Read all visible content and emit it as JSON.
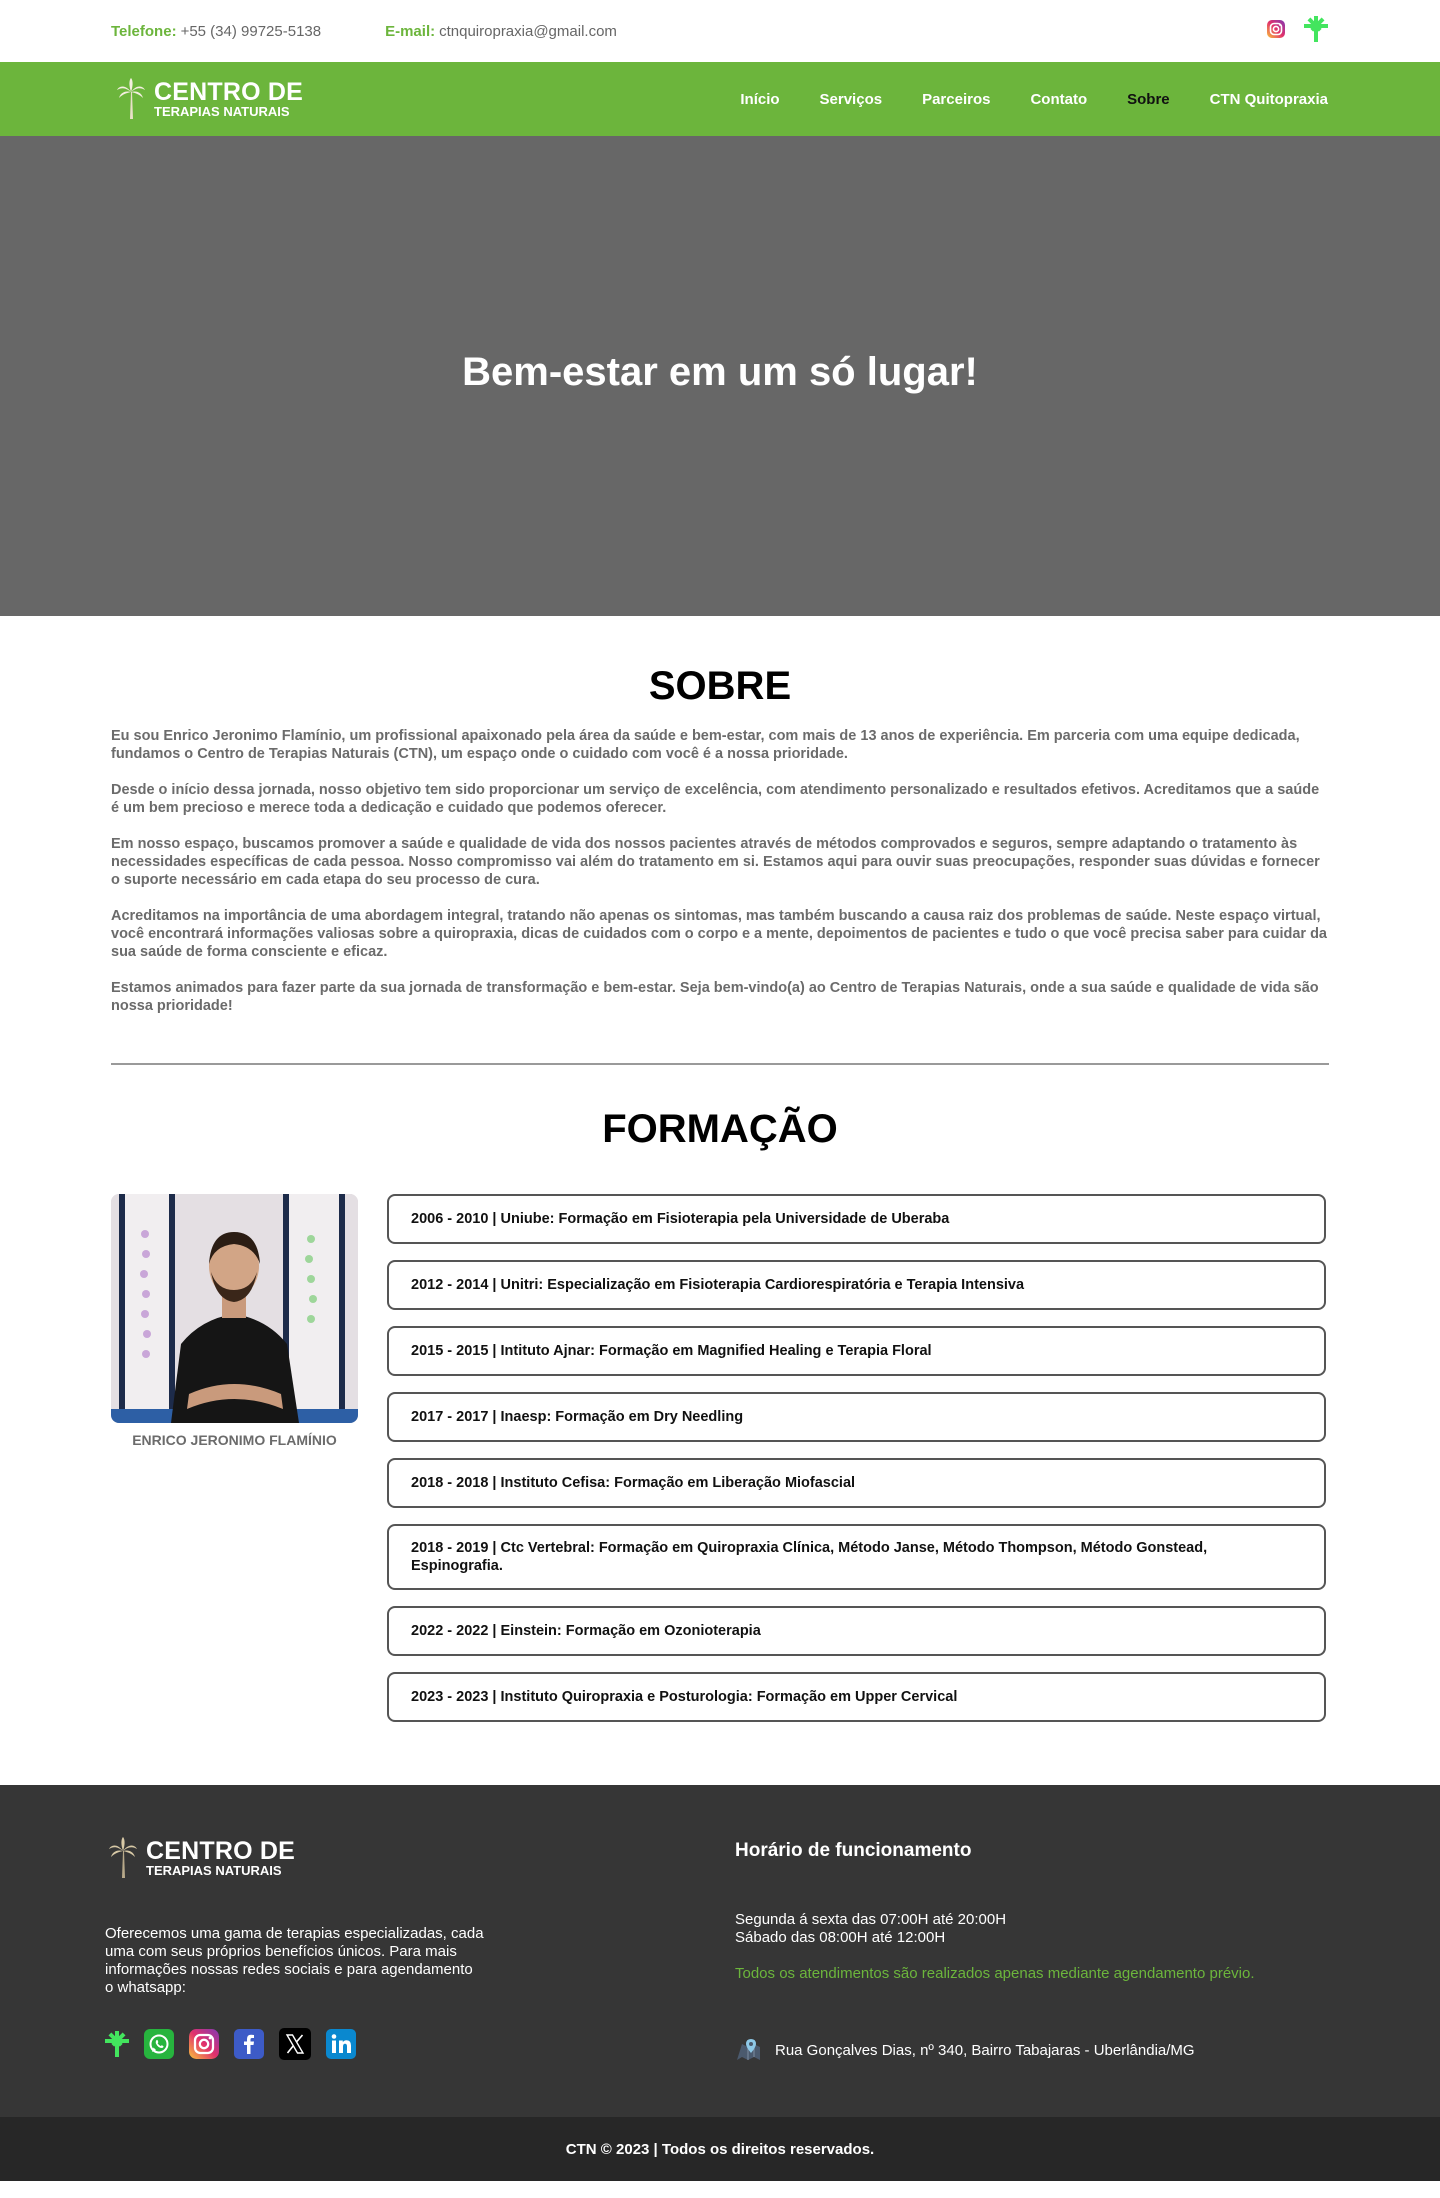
{
  "topbar": {
    "phone_label": "Telefone:",
    "phone_value": "+55 (34) 99725-5138",
    "email_label": "E-mail:",
    "email_value": "ctnquiropraxia@gmail.com",
    "social_icons": [
      "instagram-icon",
      "linktree-icon"
    ]
  },
  "brand": {
    "line1": "CENTRO DE",
    "line2": "TERAPIAS NATURAIS",
    "accent_color": "#6cb53c"
  },
  "nav": {
    "items": [
      {
        "label": "Início"
      },
      {
        "label": "Serviços"
      },
      {
        "label": "Parceiros"
      },
      {
        "label": "Contato"
      },
      {
        "label": "Sobre",
        "active": true
      },
      {
        "label": "CTN Quitopraxia"
      }
    ]
  },
  "hero": {
    "title": "Bem-estar em um só lugar!"
  },
  "sobre": {
    "title": "SOBRE",
    "paragraphs": [
      "Eu sou Enrico Jeronimo Flamínio, um profissional apaixonado pela área da saúde e bem-estar, com mais de 13 anos de experiência. Em parceria com uma equipe dedicada, fundamos o Centro de Terapias Naturais (CTN), um espaço onde o cuidado com você é a nossa prioridade.",
      "Desde o início dessa jornada, nosso objetivo tem sido proporcionar um serviço de excelência, com atendimento personalizado e resultados efetivos. Acreditamos que a saúde é um bem precioso e merece toda a dedicação e cuidado que podemos oferecer.",
      "Em nosso espaço, buscamos promover a saúde e qualidade de vida dos nossos pacientes através de métodos comprovados e seguros, sempre adaptando o tratamento às necessidades específicas de cada pessoa. Nosso compromisso vai além do tratamento em si. Estamos aqui para ouvir suas preocupações, responder suas dúvidas e fornecer o suporte necessário em cada etapa do seu processo de cura.",
      "Acreditamos na importância de uma abordagem integral, tratando não apenas os sintomas, mas também buscando a causa raiz dos problemas de saúde. Neste espaço virtual, você encontrará informações valiosas sobre a quiropraxia, dicas de cuidados com o corpo e a mente, depoimentos de pacientes e tudo o que você precisa saber para cuidar da sua saúde de forma consciente e eficaz.",
      "Estamos animados para fazer parte da sua jornada de transformação e bem-estar. Seja bem-vindo(a) ao Centro de Terapias Naturais, onde a sua saúde e qualidade de vida são nossa prioridade!"
    ]
  },
  "formacao": {
    "title": "FORMAÇÃO",
    "profile_name": "ENRICO JERONIMO FLAMÍNIO",
    "items": [
      "2006 - 2010 | Uniube: Formação em Fisioterapia pela Universidade de Uberaba",
      "2012 - 2014 | Unitri: Especialização em Fisioterapia Cardiorespiratória e Terapia Intensiva",
      "2015 - 2015 | Intituto Ajnar: Formação em Magnified Healing e Terapia Floral",
      "2017 - 2017 | Inaesp: Formação em Dry Needling",
      "2018 - 2018 | Instituto Cefisa: Formação em Liberação Miofascial",
      "2018 - 2019 | Ctc Vertebral: Formação em Quiropraxia Clínica, Método Janse, Método Thompson, Método Gonstead, Espinografia.",
      "2022 - 2022 | Einstein: Formação em Ozonioterapia",
      "2023 - 2023 | Instituto Quiropraxia e Posturologia: Formação em Upper Cervical"
    ]
  },
  "footer": {
    "description": "Oferecemos uma gama de terapias especializadas, cada uma com seus próprios benefícios únicos. Para mais informações nossas redes sociais e para agendamento o whatsapp:",
    "social_icons": [
      "linktree-icon",
      "whatsapp-icon",
      "instagram-icon",
      "facebook-icon",
      "x-icon",
      "linkedin-icon"
    ],
    "hours_title": "Horário de funcionamento",
    "hours_line1": "Segunda á sexta das 07:00H até 20:00H",
    "hours_line2": "Sábado das 08:00H até 12:00H",
    "note": "Todos os atendimentos são realizados apenas mediante agendamento prévio.",
    "address": "Rua Gonçalves Dias, nº 340, Bairro Tabajaras - Uberlândia/MG",
    "copyright": "CTN © 2023 | Todos os direitos reservados."
  }
}
